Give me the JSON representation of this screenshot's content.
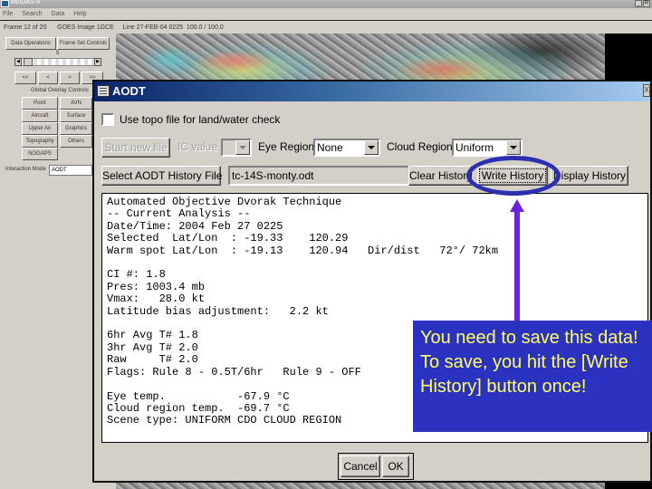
{
  "app": {
    "title": "McIDAS-V",
    "window_controls": [
      "_",
      "R"
    ],
    "menu": [
      "File",
      "Search",
      "Data",
      "Help"
    ],
    "status_line": "Frame 12 of 20      GOES Image 1GCE     Line 27-FEB-04 0225  100.0 / 100.0",
    "left_panel": {
      "top_buttons": [
        "Data Operations",
        "Frame Set Controls"
      ],
      "frame_number": "5",
      "nav_buttons": [
        "<<",
        "<",
        ">",
        ">>"
      ],
      "overlay_title": "Global Overlay Controls",
      "overlay_buttons": [
        "Point",
        "AVN",
        "Aircraft",
        "Surface",
        "Upper Air",
        "Graphics",
        "Topography",
        "Others",
        "NOGAPS"
      ],
      "interaction_mode_label": "Interaction Mode",
      "interaction_mode_value": "AODT"
    }
  },
  "dialog": {
    "title": "AODT",
    "close_glyph": "X",
    "topo_checkbox": {
      "label": "Use topo file for land/water check",
      "checked": false
    },
    "start_new_file": "Start new file",
    "ic_value_label": "IC value",
    "ic_value": "",
    "eye_region_label": "Eye Region",
    "eye_region_value": "None",
    "cloud_region_label": "Cloud Region",
    "cloud_region_value": "Uniform",
    "select_history_button": "Select AODT History File",
    "history_file": "tc-14S-monty.odt",
    "clear_history": "Clear History",
    "write_history": "Write History",
    "display_history": "Display History",
    "output_text": "Automated Objective Dvorak Technique\n-- Current Analysis --\nDate/Time: 2004 Feb 27 0225\nSelected  Lat/Lon  : -19.33    120.29\nWarm spot Lat/Lon  : -19.13    120.94   Dir/dist   72°/ 72km\n\nCI #: 1.8\nPres: 1003.4 mb\nVmax:   28.0 kt\nLatitude bias adjustment:   2.2 kt\n\n6hr Avg T# 1.8\n3hr Avg T# 2.0\nRaw     T# 2.0\nFlags: Rule 8 - 0.5T/6hr   Rule 9 - OFF\n\nEye temp.           -67.9 °C\nCloud region temp.  -69.7 °C\nScene type: UNIFORM CDO CLOUD REGION",
    "cancel": "Cancel",
    "ok": "OK"
  },
  "annotation": {
    "callout_text": "You need to save this data! To save, you hit the [Write History] button once!",
    "callout_bg": "#2c32c0",
    "callout_fg": "#ffff66",
    "arrow_color": "#6a22e0",
    "ellipse_color": "#2b2fb0"
  }
}
